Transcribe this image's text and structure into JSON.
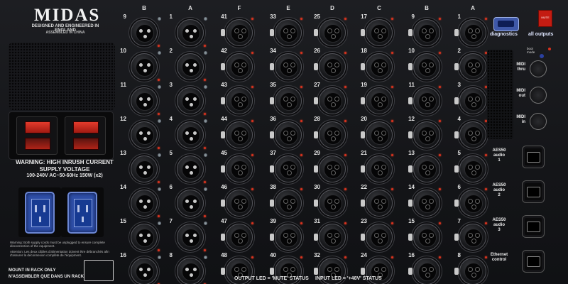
{
  "branding": {
    "logo": "MIDAS",
    "designed": "DESIGNED AND ENGINEERED IN ENGLAND",
    "assembled": "ASSEMBLED IN CHINA"
  },
  "power": {
    "warning_line1": "WARNING: HIGH INRUSH CURRENT",
    "warning_line2": "SUPPLY VOLTAGE",
    "warning_line3": "100-240V  AC~50-60Hz 150W (x2)",
    "notice_en": "Warning: Both supply cords must be unplugged to ensure complete disconnection of the equipment.",
    "notice_fr": "Attention: Les deux câbles d'alimentation doivent être débranchés afin d'assurer la déconnexion complète de l'équipment.",
    "mount_en": "MOUNT IN RACK ONLY",
    "mount_fr": "N'ASSEMBLER QUE DANS UN RACK"
  },
  "outputs": {
    "columns": [
      {
        "header": "B",
        "numbers": [
          "9",
          "10",
          "11",
          "12",
          "13",
          "14",
          "15",
          "16"
        ]
      },
      {
        "header": "A",
        "numbers": [
          "1",
          "2",
          "3",
          "4",
          "5",
          "6",
          "7",
          "8"
        ]
      }
    ]
  },
  "inputs": {
    "columns": [
      {
        "header": "F",
        "numbers": [
          "41",
          "42",
          "43",
          "44",
          "45",
          "46",
          "47",
          "48"
        ]
      },
      {
        "header": "E",
        "numbers": [
          "33",
          "34",
          "35",
          "36",
          "37",
          "38",
          "39",
          "40"
        ]
      },
      {
        "header": "D",
        "numbers": [
          "25",
          "26",
          "27",
          "28",
          "29",
          "30",
          "31",
          "32"
        ]
      },
      {
        "header": "C",
        "numbers": [
          "17",
          "18",
          "19",
          "20",
          "21",
          "22",
          "23",
          "24"
        ]
      },
      {
        "header": "B",
        "numbers": [
          "9",
          "10",
          "11",
          "12",
          "13",
          "14",
          "15",
          "16"
        ]
      },
      {
        "header": "A",
        "numbers": [
          "1",
          "2",
          "3",
          "4",
          "5",
          "6",
          "7",
          "8"
        ]
      }
    ]
  },
  "right_panel": {
    "diagnostics": "diagnostics",
    "mute": "MUTE",
    "all_outputs": "all outputs",
    "boot": "boot",
    "boot2": "mode",
    "midi": [
      {
        "l1": "MIDI",
        "l2": "thru"
      },
      {
        "l1": "MIDI",
        "l2": "out"
      },
      {
        "l1": "MIDI",
        "l2": "in"
      }
    ],
    "network": [
      {
        "l1": "AES50",
        "l2": "audio",
        "l3": "1"
      },
      {
        "l1": "AES50",
        "l2": "audio",
        "l3": "2"
      },
      {
        "l1": "AES50",
        "l2": "audio",
        "l3": "3"
      },
      {
        "l1": "Ethernet",
        "l2": "control",
        "l3": ""
      }
    ]
  },
  "status": {
    "output_led": "OUTPUT LED = 'MUTE' STATUS",
    "input_led": "INPUT LED = '+48V' STATUS"
  },
  "colors": {
    "panel": "#16171a",
    "led": "#d8321e",
    "iec_blue": "#2f4fa8",
    "rocker_red": "#e43b2c"
  }
}
